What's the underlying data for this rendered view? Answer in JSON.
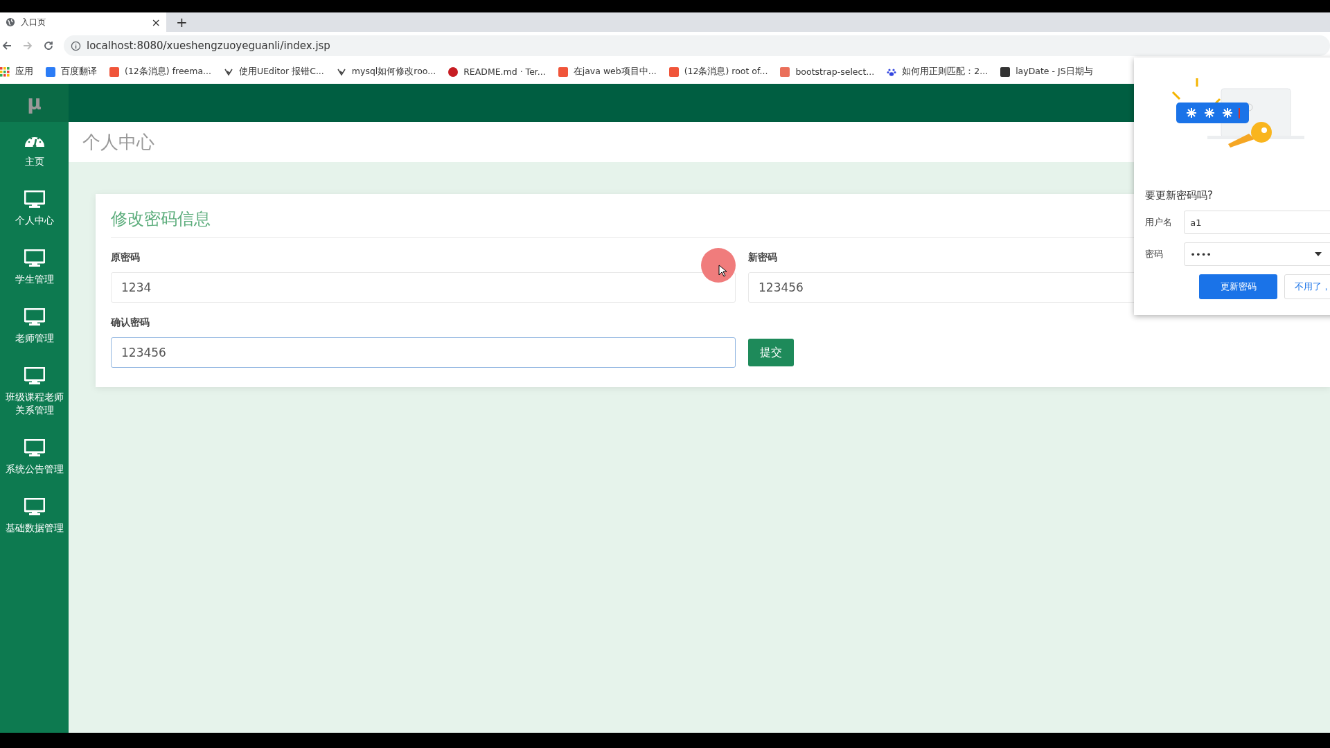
{
  "browser": {
    "tab": {
      "title": "入口页",
      "close": "×"
    },
    "new_tab": "+",
    "url": "localhost:8080/xueshengzuoyeguanli/index.jsp",
    "bookmarks": [
      {
        "kind": "apps",
        "label": "应用"
      },
      {
        "kind": "translate",
        "label": "百度翻译"
      },
      {
        "kind": "csdn",
        "label": "(12条消息) freema..."
      },
      {
        "kind": "yuque",
        "label": "使用UEditor 报错C..."
      },
      {
        "kind": "yuque",
        "label": "mysql如何修改roo..."
      },
      {
        "kind": "gitee",
        "label": "README.md · Ter..."
      },
      {
        "kind": "csdn",
        "label": "在java web项目中..."
      },
      {
        "kind": "csdn",
        "label": "(12条消息) root of..."
      },
      {
        "kind": "jianshu",
        "label": "bootstrap-select..."
      },
      {
        "kind": "baidu",
        "label": "如何用正则匹配：2..."
      },
      {
        "kind": "laydate",
        "label": "layDate - JS日期与"
      }
    ]
  },
  "sidebar": {
    "logo": "μ",
    "items": [
      {
        "kind": "dashboard",
        "label": "主页"
      },
      {
        "kind": "monitor",
        "label": "个人中心"
      },
      {
        "kind": "monitor",
        "label": "学生管理"
      },
      {
        "kind": "monitor",
        "label": "老师管理"
      },
      {
        "kind": "monitor",
        "label": "班级课程老师关系管理"
      },
      {
        "kind": "monitor",
        "label": "系统公告管理"
      },
      {
        "kind": "monitor",
        "label": "基础数据管理"
      }
    ]
  },
  "page_title": "个人中心",
  "card": {
    "title": "修改密码信息",
    "fields": [
      {
        "label": "原密码",
        "value": "1234",
        "focused": false
      },
      {
        "label": "新密码",
        "value": "123456",
        "focused": false
      },
      {
        "label": "确认密码",
        "value": "123456",
        "focused": true
      }
    ],
    "submit": "提交"
  },
  "password_popup": {
    "title": "要更新密码吗?",
    "username_label": "用户名",
    "username": "a1",
    "password_label": "密码",
    "password": "••••",
    "primary": "更新密码",
    "secondary": "不用了，"
  }
}
